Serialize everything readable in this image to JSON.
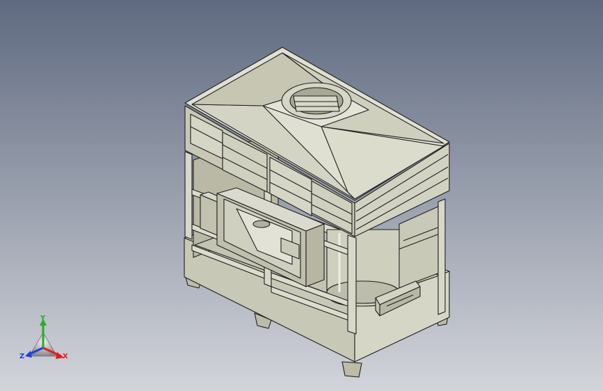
{
  "viewport": {
    "background_top": "#5f6a80",
    "background_bottom": "#d2d4da"
  },
  "model": {
    "face_color": "#cdcdbb",
    "face_light": "#dadace",
    "face_dark": "#a6a692",
    "edge_color": "#1e1e1e"
  },
  "triad": {
    "x_label": "X",
    "y_label": "Y",
    "z_label": "Z",
    "x_color": "#e0201e",
    "y_color": "#22b022",
    "z_color": "#2040e0"
  }
}
